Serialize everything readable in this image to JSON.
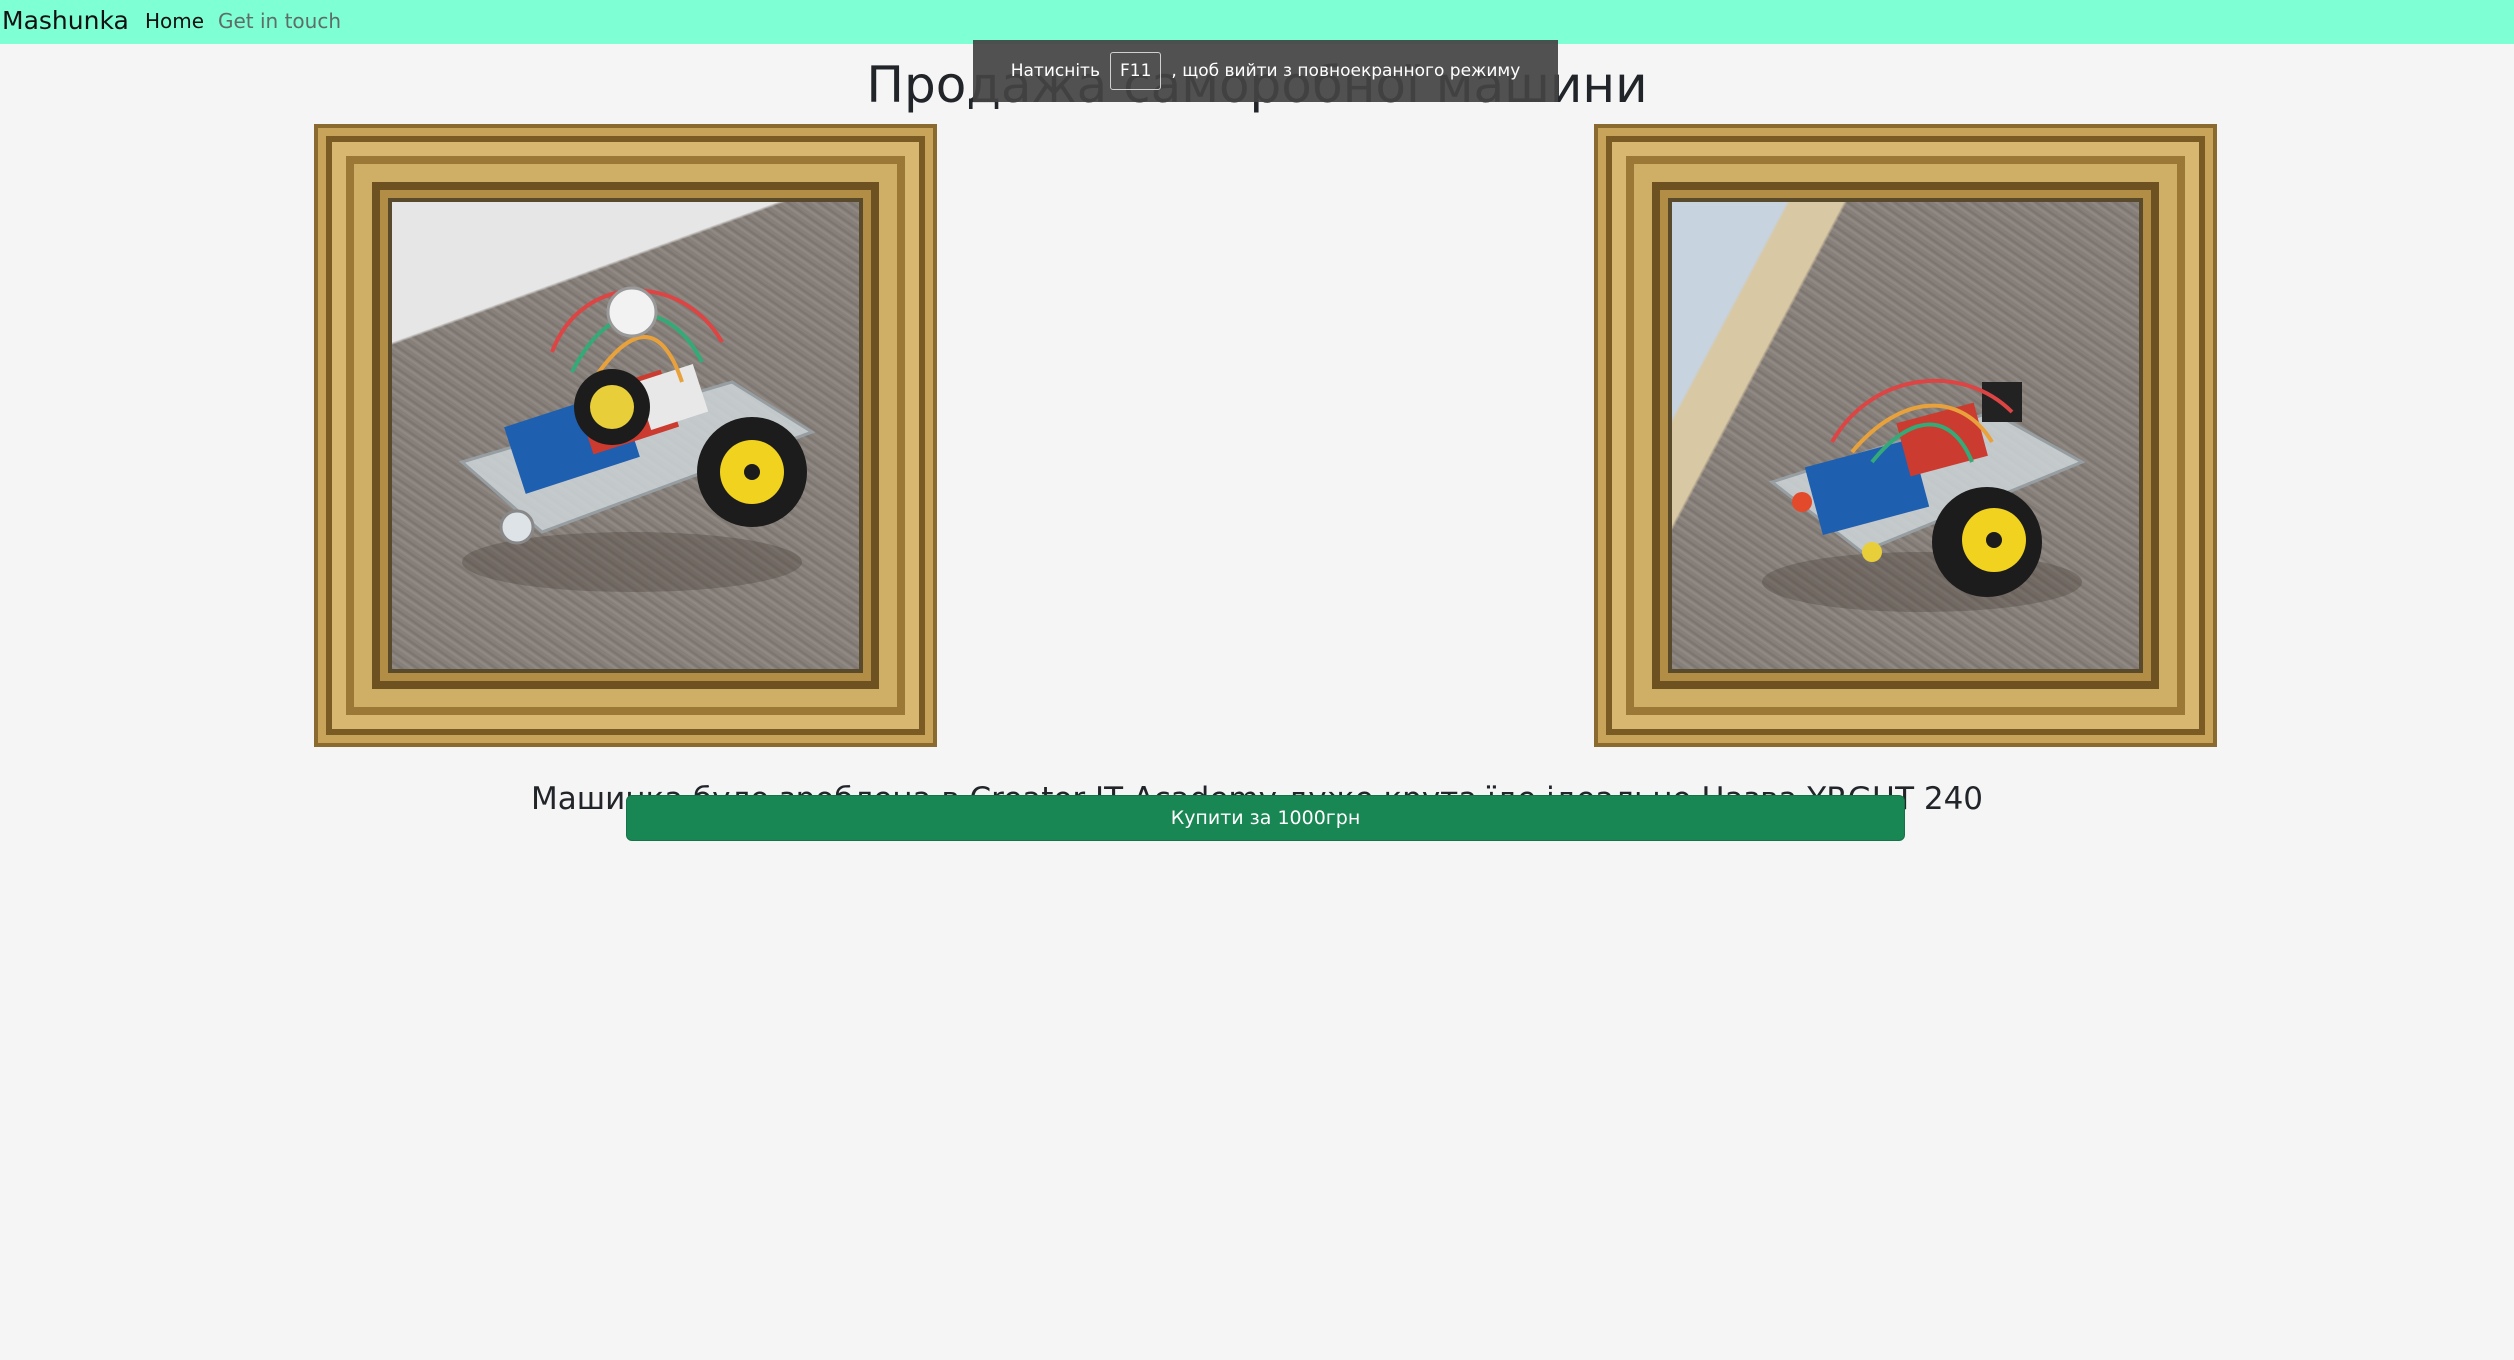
{
  "navbar": {
    "brand": "Mashunka",
    "links": [
      {
        "label": "Home"
      },
      {
        "label": "Get in touch"
      }
    ],
    "background_color": "#7fffd4"
  },
  "page": {
    "title": "Продажа саморобної машини",
    "description": "Машинка було зроблена в Creator IT Academy дуже крута їде ідеально.Назва YRGHT 240",
    "buy_button_label": "Купити за 1000грн",
    "buy_button_color": "#198754"
  },
  "fullscreen_notice": {
    "before": "Натисніть",
    "key": "F11",
    "after": ", щоб вийти з повноекранного режиму"
  },
  "images": [
    {
      "name": "robot-car-photo-left",
      "frame": "gold"
    },
    {
      "name": "robot-car-photo-right",
      "frame": "gold"
    }
  ]
}
